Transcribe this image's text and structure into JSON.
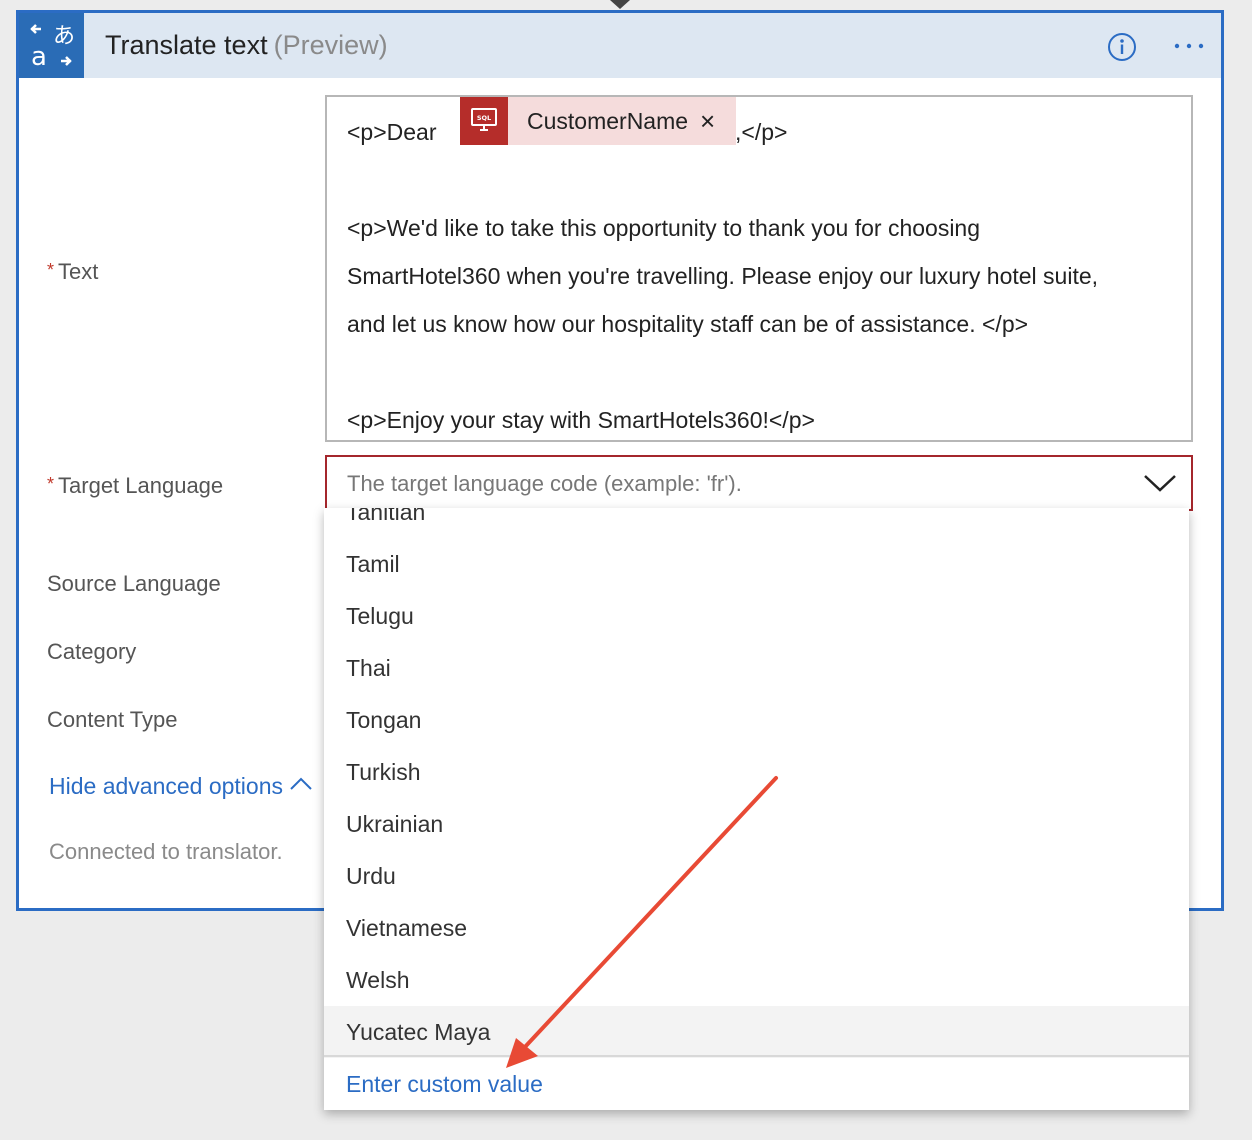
{
  "card": {
    "title": "Translate text",
    "title_suffix": "(Preview)"
  },
  "fields": {
    "text_label": "Text",
    "target_language_label": "Target Language",
    "source_language_label": "Source Language",
    "category_label": "Category",
    "content_type_label": "Content Type",
    "required_marker": "*"
  },
  "text_editor": {
    "line1_prefix": "<p>Dear",
    "token_label": "CustomerName",
    "token_icon": "sql-server-icon",
    "token_close": "×",
    "line1_suffix": ",</p>",
    "line2": "<p>We'd like to take this opportunity to thank you for choosing",
    "line3": "SmartHotel360 when you're travelling. Please enjoy our luxury hotel suite,",
    "line4": "and let us know how our hospitality staff can be of assistance. </p>",
    "line5": "<p>Enjoy your stay with SmartHotels360!</p>"
  },
  "target_language": {
    "placeholder": "The target language code (example: 'fr')."
  },
  "dropdown": {
    "partial_item": "Tahitian",
    "items": [
      "Tamil",
      "Telugu",
      "Thai",
      "Tongan",
      "Turkish",
      "Ukrainian",
      "Urdu",
      "Vietnamese",
      "Welsh",
      "Yucatec Maya"
    ],
    "highlighted_item": "Yucatec Maya",
    "custom_value_label": "Enter custom value"
  },
  "advanced_toggle_label": "Hide advanced options",
  "connection_status": "Connected to translator.",
  "colors": {
    "header_bg": "#dde7f2",
    "accent_blue": "#2b6cc4",
    "icon_box": "#2a6cb6",
    "token_bg": "#f5dcdc",
    "token_icon_bg": "#b52d2a",
    "error_border": "#a4262c",
    "annotation_arrow": "#e84a35"
  }
}
